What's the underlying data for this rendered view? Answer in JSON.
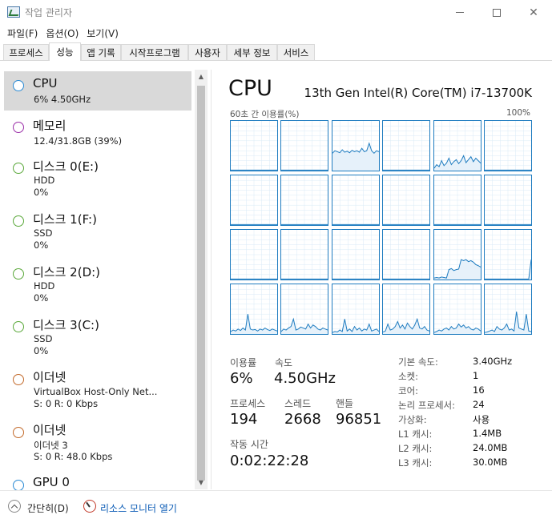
{
  "window": {
    "title": "작업 관리자"
  },
  "menu": {
    "items": [
      "파일(F)",
      "옵션(O)",
      "보기(V)"
    ]
  },
  "tabs": [
    "프로세스",
    "성능",
    "앱 기록",
    "시작프로그램",
    "사용자",
    "세부 정보",
    "서비스"
  ],
  "resources": [
    {
      "name": "CPU",
      "sub1": "6%  4.50GHz",
      "sub2": "",
      "color": "#2a8ad4"
    },
    {
      "name": "메모리",
      "sub1": "12.4/31.8GB (39%)",
      "sub2": "",
      "color": "#9b2ea8"
    },
    {
      "name": "디스크 0(E:)",
      "sub1": "HDD",
      "sub2": "0%",
      "color": "#5aa83a"
    },
    {
      "name": "디스크 1(F:)",
      "sub1": "SSD",
      "sub2": "0%",
      "color": "#5aa83a"
    },
    {
      "name": "디스크 2(D:)",
      "sub1": "HDD",
      "sub2": "0%",
      "color": "#5aa83a"
    },
    {
      "name": "디스크 3(C:)",
      "sub1": "SSD",
      "sub2": "0%",
      "color": "#5aa83a"
    },
    {
      "name": "이더넷",
      "sub1": "VirtualBox Host-Only Net...",
      "sub2": "S: 0  R: 0 Kbps",
      "color": "#c2692a"
    },
    {
      "name": "이더넷",
      "sub1": "이더넷 3",
      "sub2": "S: 0  R: 48.0 Kbps",
      "color": "#c2692a"
    },
    {
      "name": "GPU 0",
      "sub1": "",
      "sub2": "",
      "color": "#2a8ad4"
    }
  ],
  "cpu": {
    "title": "CPU",
    "model": "13th Gen Intel(R) Core(TM) i7-13700K",
    "graph_label_left": "60초 간 이용률(%)",
    "graph_label_right": "100%",
    "utilization_label": "이용률",
    "utilization_value": "6%",
    "speed_label": "속도",
    "speed_value": "4.50GHz",
    "processes_label": "프로세스",
    "processes_value": "194",
    "threads_label": "스레드",
    "threads_value": "2668",
    "handles_label": "핸들",
    "handles_value": "96851",
    "uptime_label": "작동 시간",
    "uptime_value": "0:02:22:28",
    "specs": [
      {
        "key": "기본 속도:",
        "value": "3.40GHz"
      },
      {
        "key": "소켓:",
        "value": "1"
      },
      {
        "key": "코어:",
        "value": "16"
      },
      {
        "key": "논리 프로세서:",
        "value": "24"
      },
      {
        "key": "가상화:",
        "value": "사용"
      },
      {
        "key": "L1 캐시:",
        "value": "1.4MB"
      },
      {
        "key": "L2 캐시:",
        "value": "24.0MB"
      },
      {
        "key": "L3 캐시:",
        "value": "30.0MB"
      }
    ],
    "core_graph_series": [
      [
        2,
        2,
        3,
        2,
        2,
        3,
        2,
        2,
        3,
        2,
        2,
        2,
        3,
        2,
        3,
        2,
        2,
        2,
        3,
        2
      ],
      [
        1,
        1,
        1,
        1,
        1,
        1,
        1,
        2,
        1,
        1,
        1,
        1,
        1,
        1,
        1,
        1,
        1,
        1,
        1,
        1
      ],
      [
        1,
        1,
        1,
        1,
        1,
        1,
        1,
        1,
        1,
        1,
        1,
        1,
        1,
        1,
        1,
        1,
        1,
        1,
        1,
        1
      ],
      [
        1,
        1,
        1,
        1,
        1,
        1,
        1,
        1,
        1,
        1,
        1,
        1,
        1,
        1,
        1,
        1,
        1,
        1,
        1,
        1
      ],
      [
        1,
        1,
        1,
        1,
        1,
        1,
        1,
        1,
        1,
        1,
        1,
        1,
        1,
        1,
        1,
        1,
        1,
        1,
        1,
        1
      ],
      [
        1,
        1,
        1,
        1,
        1,
        1,
        1,
        1,
        1,
        1,
        1,
        1,
        1,
        1,
        1,
        1,
        1,
        1,
        1,
        1
      ],
      [
        1,
        1,
        1,
        1,
        1,
        1,
        1,
        1,
        1,
        1,
        1,
        1,
        1,
        1,
        1,
        1,
        1,
        1,
        1,
        1
      ],
      [
        1,
        1,
        1,
        1,
        1,
        1,
        1,
        1,
        1,
        1,
        1,
        1,
        1,
        1,
        1,
        1,
        1,
        1,
        1,
        1
      ],
      [
        35,
        40,
        38,
        36,
        42,
        37,
        39,
        36,
        41,
        38,
        40,
        37,
        45,
        38,
        40,
        55,
        40,
        35,
        40,
        38
      ],
      [
        1,
        1,
        1,
        1,
        1,
        1,
        1,
        1,
        1,
        1,
        1,
        1,
        1,
        1,
        1,
        1,
        1,
        1,
        1,
        1
      ],
      [
        5,
        12,
        8,
        20,
        10,
        15,
        25,
        12,
        18,
        22,
        14,
        20,
        30,
        16,
        22,
        28,
        18,
        25,
        20,
        15
      ],
      [
        1,
        1,
        1,
        1,
        1,
        1,
        1,
        1,
        1,
        1,
        1,
        1,
        1,
        1,
        1,
        1,
        1,
        1,
        1,
        1
      ],
      [
        1,
        1,
        1,
        1,
        1,
        1,
        1,
        1,
        1,
        1,
        1,
        1,
        1,
        1,
        1,
        1,
        1,
        1,
        1,
        1
      ],
      [
        1,
        1,
        1,
        1,
        1,
        1,
        1,
        1,
        1,
        1,
        1,
        1,
        1,
        1,
        1,
        1,
        1,
        1,
        1,
        1
      ],
      [
        1,
        1,
        1,
        1,
        1,
        1,
        1,
        1,
        1,
        1,
        1,
        1,
        1,
        1,
        1,
        1,
        1,
        1,
        1,
        1
      ],
      [
        1,
        1,
        1,
        1,
        1,
        1,
        1,
        1,
        1,
        1,
        1,
        1,
        1,
        1,
        1,
        1,
        1,
        1,
        1,
        1
      ],
      [
        1,
        1,
        1,
        1,
        1,
        1,
        1,
        1,
        1,
        1,
        1,
        1,
        1,
        1,
        1,
        1,
        1,
        1,
        1,
        1
      ],
      [
        1,
        1,
        1,
        1,
        1,
        1,
        1,
        1,
        1,
        1,
        1,
        1,
        1,
        1,
        1,
        1,
        1,
        1,
        1,
        1
      ],
      [
        1,
        1,
        1,
        1,
        1,
        1,
        1,
        1,
        1,
        1,
        1,
        1,
        1,
        1,
        1,
        1,
        1,
        1,
        1,
        1
      ],
      [
        1,
        1,
        1,
        1,
        1,
        1,
        1,
        1,
        1,
        1,
        1,
        1,
        1,
        1,
        1,
        1,
        1,
        1,
        1,
        1
      ],
      [
        1,
        1,
        1,
        1,
        1,
        1,
        1,
        1,
        1,
        1,
        1,
        1,
        1,
        1,
        1,
        1,
        1,
        1,
        1,
        1
      ],
      [
        1,
        1,
        1,
        1,
        1,
        1,
        1,
        1,
        1,
        1,
        1,
        1,
        1,
        1,
        1,
        1,
        1,
        1,
        1,
        1
      ],
      [
        3,
        4,
        3,
        5,
        4,
        3,
        20,
        22,
        18,
        20,
        21,
        40,
        38,
        40,
        36,
        38,
        35,
        30,
        28,
        25
      ],
      [
        1,
        1,
        1,
        1,
        1,
        1,
        1,
        1,
        1,
        1,
        1,
        1,
        1,
        1,
        1,
        1,
        1,
        1,
        1,
        40
      ],
      [
        5,
        8,
        6,
        10,
        7,
        12,
        8,
        40,
        10,
        8,
        9,
        6,
        10,
        8,
        12,
        9,
        7,
        10,
        8,
        6
      ],
      [
        5,
        10,
        8,
        12,
        15,
        30,
        8,
        10,
        14,
        12,
        10,
        20,
        12,
        18,
        15,
        10,
        8,
        12,
        10,
        8
      ],
      [
        3,
        5,
        4,
        8,
        5,
        30,
        6,
        10,
        5,
        15,
        8,
        12,
        6,
        10,
        8,
        20,
        6,
        8,
        10,
        5
      ],
      [
        4,
        6,
        20,
        8,
        10,
        15,
        25,
        12,
        18,
        10,
        22,
        15,
        10,
        18,
        30,
        12,
        10,
        15,
        8,
        6
      ],
      [
        3,
        5,
        8,
        6,
        10,
        12,
        8,
        15,
        10,
        12,
        20,
        14,
        18,
        12,
        15,
        10,
        8,
        12,
        10,
        6
      ],
      [
        3,
        4,
        6,
        8,
        5,
        15,
        10,
        8,
        12,
        20,
        8,
        10,
        6,
        45,
        12,
        10,
        8,
        40,
        6,
        5
      ]
    ]
  },
  "bottom": {
    "brief_label": "간단히(D)",
    "monitor_label": "리소스 모니터 열기"
  }
}
